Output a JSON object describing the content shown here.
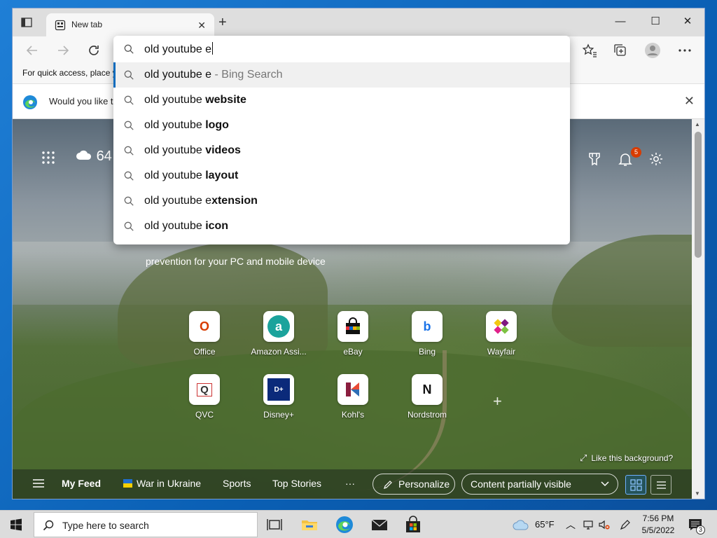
{
  "browser": {
    "tab": {
      "title": "New tab",
      "close": "✕"
    },
    "new_tab": "+",
    "window": {
      "minimize": "—",
      "maximize": "☐",
      "close": "✕"
    },
    "favorites_bar_text": "For quick access, place y",
    "infobar_text": "Would you like t",
    "infobar_close": "✕"
  },
  "omnibox": {
    "input_value": "old youtube e",
    "suggestions": [
      {
        "prefix": "old youtube e",
        "bold": "",
        "hint": " - Bing Search"
      },
      {
        "prefix": "old youtube ",
        "bold": "website",
        "hint": ""
      },
      {
        "prefix": "old youtube ",
        "bold": "logo",
        "hint": ""
      },
      {
        "prefix": "old youtube ",
        "bold": "videos",
        "hint": ""
      },
      {
        "prefix": "old youtube ",
        "bold": "layout",
        "hint": ""
      },
      {
        "prefix": "old youtube e",
        "bold": "xtension",
        "hint": ""
      },
      {
        "prefix": "old youtube ",
        "bold": "icon",
        "hint": ""
      }
    ]
  },
  "newtab": {
    "weather_temp": "64",
    "notification_count": "5",
    "promo_text": "prevention for your PC and mobile device",
    "tiles": [
      {
        "label": "Office",
        "glyph": "O",
        "color": "#d83b01"
      },
      {
        "label": "Amazon Assi...",
        "glyph": "a",
        "color": "#1ba39c"
      },
      {
        "label": "eBay",
        "glyph": "▆",
        "color": "#e53238"
      },
      {
        "label": "Bing",
        "glyph": "b",
        "color": "#1a73e8"
      },
      {
        "label": "Wayfair",
        "glyph": "✦",
        "color": "#7f187f"
      },
      {
        "label": "QVC",
        "glyph": "Q",
        "color": "#333333"
      },
      {
        "label": "Disney+",
        "glyph": "D+",
        "color": "#ffffff"
      },
      {
        "label": "Kohl's",
        "glyph": "K",
        "color": "#8b1e3f"
      },
      {
        "label": "Nordstrom",
        "glyph": "N",
        "color": "#111111"
      }
    ],
    "add_tile": "+",
    "like_background": "Like this background?",
    "feed": {
      "my_feed": "My Feed",
      "war_in_ukraine": "War in Ukraine",
      "sports": "Sports",
      "top_stories": "Top Stories",
      "more": "···",
      "personalize": "Personalize",
      "content_visibility": "Content partially visible"
    }
  },
  "taskbar": {
    "search_placeholder": "Type here to search",
    "weather": "65°F",
    "time": "7:56 PM",
    "date": "5/5/2022",
    "notification_count": "3"
  },
  "colors": {
    "accent": "#0f6cbd",
    "badge": "#d83b01"
  }
}
